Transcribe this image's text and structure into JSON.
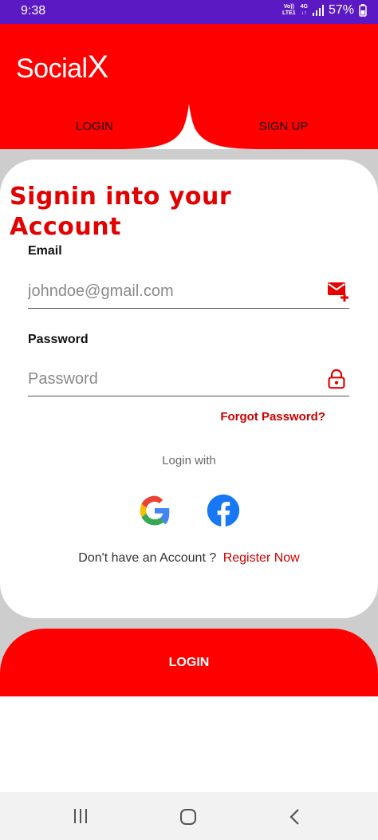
{
  "status_bar": {
    "time": "9:38",
    "network_top": "Vo))",
    "network_bottom": "LTE1",
    "data_top": "4G",
    "data_bottom": "↓↑",
    "battery": "57%",
    "background_color": "#5b19c4"
  },
  "header": {
    "app_name_prefix": "Social",
    "app_name_suffix": "X",
    "tabs": [
      {
        "label": "LOGIN"
      },
      {
        "label": "SIGN UP"
      }
    ],
    "background_color": "#ff0000"
  },
  "card": {
    "title_line1": "Signin into your",
    "title_line2": "Account",
    "email": {
      "label": "Email",
      "placeholder": "johndoe@gmail.com",
      "icon": "mail-add-icon"
    },
    "password": {
      "label": "Password",
      "placeholder": "Password",
      "icon": "lock-icon"
    },
    "forgot_password": "Forgot Password?",
    "login_with": "Login with",
    "social": [
      {
        "name": "google-icon"
      },
      {
        "name": "facebook-icon"
      }
    ],
    "register_prompt": "Don't have an Account ?",
    "register_link": "Register Now"
  },
  "login_button": {
    "label": "LOGIN"
  },
  "nav_bar": {
    "icons": [
      "recent-apps-icon",
      "home-icon",
      "back-icon"
    ]
  },
  "colors": {
    "accent": "#ff0000",
    "link": "#cc0000",
    "backdrop": "#cdcdcd"
  }
}
